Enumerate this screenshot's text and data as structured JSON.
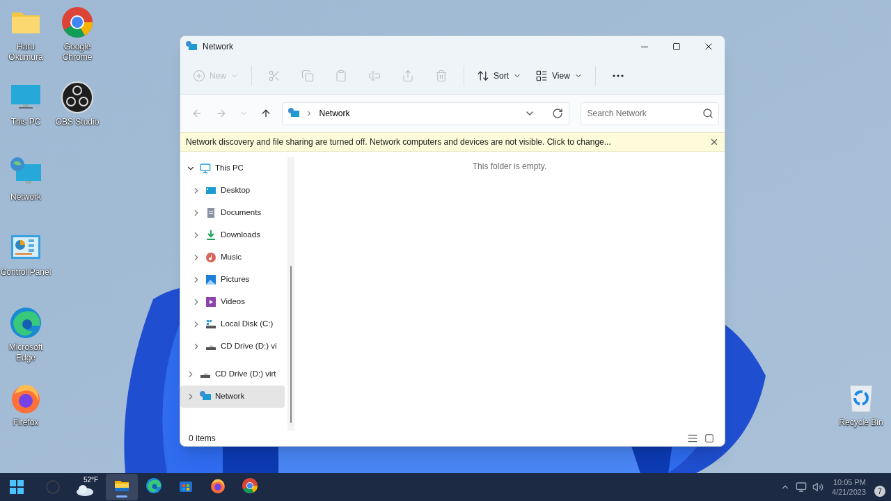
{
  "desktop_icons": [
    {
      "label": "Haru Okumura",
      "kind": "folder"
    },
    {
      "label": "Google Chrome",
      "kind": "chrome"
    },
    {
      "label": "This PC",
      "kind": "pc"
    },
    {
      "label": "OBS Studio",
      "kind": "obs"
    },
    {
      "label": "Network",
      "kind": "network"
    },
    {
      "label": "Control Panel",
      "kind": "control"
    },
    {
      "label": "Microsoft Edge",
      "kind": "edge"
    },
    {
      "label": "Firefox",
      "kind": "firefox"
    },
    {
      "label": "Recycle Bin",
      "kind": "recycle"
    }
  ],
  "window": {
    "title": "Network",
    "toolbar": [
      {
        "kind": "new",
        "label": "New",
        "disabled": true
      },
      {
        "kind": "cut",
        "disabled": true
      },
      {
        "kind": "copy",
        "disabled": true
      },
      {
        "kind": "paste",
        "disabled": true
      },
      {
        "kind": "rename",
        "disabled": true
      },
      {
        "kind": "share",
        "disabled": true
      },
      {
        "kind": "delete",
        "disabled": true
      },
      {
        "kind": "sort",
        "label": "Sort",
        "disabled": false
      },
      {
        "kind": "view",
        "label": "View",
        "disabled": false
      },
      {
        "kind": "more",
        "disabled": false
      }
    ],
    "nav": {
      "back_disabled": true,
      "forward_disabled": true
    },
    "address": {
      "location": "Network"
    },
    "search": {
      "placeholder": "Search Network"
    },
    "info_bar": "Network discovery and file sharing are turned off. Network computers and devices are not visible. Click to change...",
    "sidebar": [
      {
        "label": "This PC",
        "kind": "pc",
        "expanded": true,
        "selected": false,
        "children": [
          {
            "label": "Desktop",
            "kind": "desktop",
            "expanded": false,
            "selected": false
          },
          {
            "label": "Documents",
            "kind": "documents",
            "expanded": false,
            "selected": false
          },
          {
            "label": "Downloads",
            "kind": "downloads",
            "expanded": false,
            "selected": false
          },
          {
            "label": "Music",
            "kind": "music",
            "expanded": false,
            "selected": false
          },
          {
            "label": "Pictures",
            "kind": "pictures",
            "expanded": false,
            "selected": false
          },
          {
            "label": "Videos",
            "kind": "videos",
            "expanded": false,
            "selected": false
          },
          {
            "label": "Local Disk (C:)",
            "kind": "disk",
            "expanded": false,
            "selected": false
          },
          {
            "label": "CD Drive (D:) vi",
            "kind": "cd",
            "expanded": false,
            "selected": false
          }
        ]
      },
      {
        "label": "CD Drive (D:) virt",
        "kind": "cd",
        "expanded": false,
        "selected": false
      },
      {
        "label": "Network",
        "kind": "network",
        "expanded": false,
        "selected": true
      }
    ],
    "empty_message": "This folder is empty.",
    "status": "0 items",
    "views": [
      {
        "kind": "details",
        "selected": false
      },
      {
        "kind": "tiles",
        "selected": false
      }
    ]
  },
  "taskbar": {
    "weather": "52°F",
    "apps": [
      {
        "kind": "explorer",
        "selected": true
      },
      {
        "kind": "edge",
        "selected": false
      },
      {
        "kind": "store",
        "selected": false
      },
      {
        "kind": "firefox",
        "selected": false
      },
      {
        "kind": "chrome",
        "selected": false
      }
    ],
    "time": "10:05 PM",
    "date": "4/21/2023",
    "notifications": "7"
  }
}
